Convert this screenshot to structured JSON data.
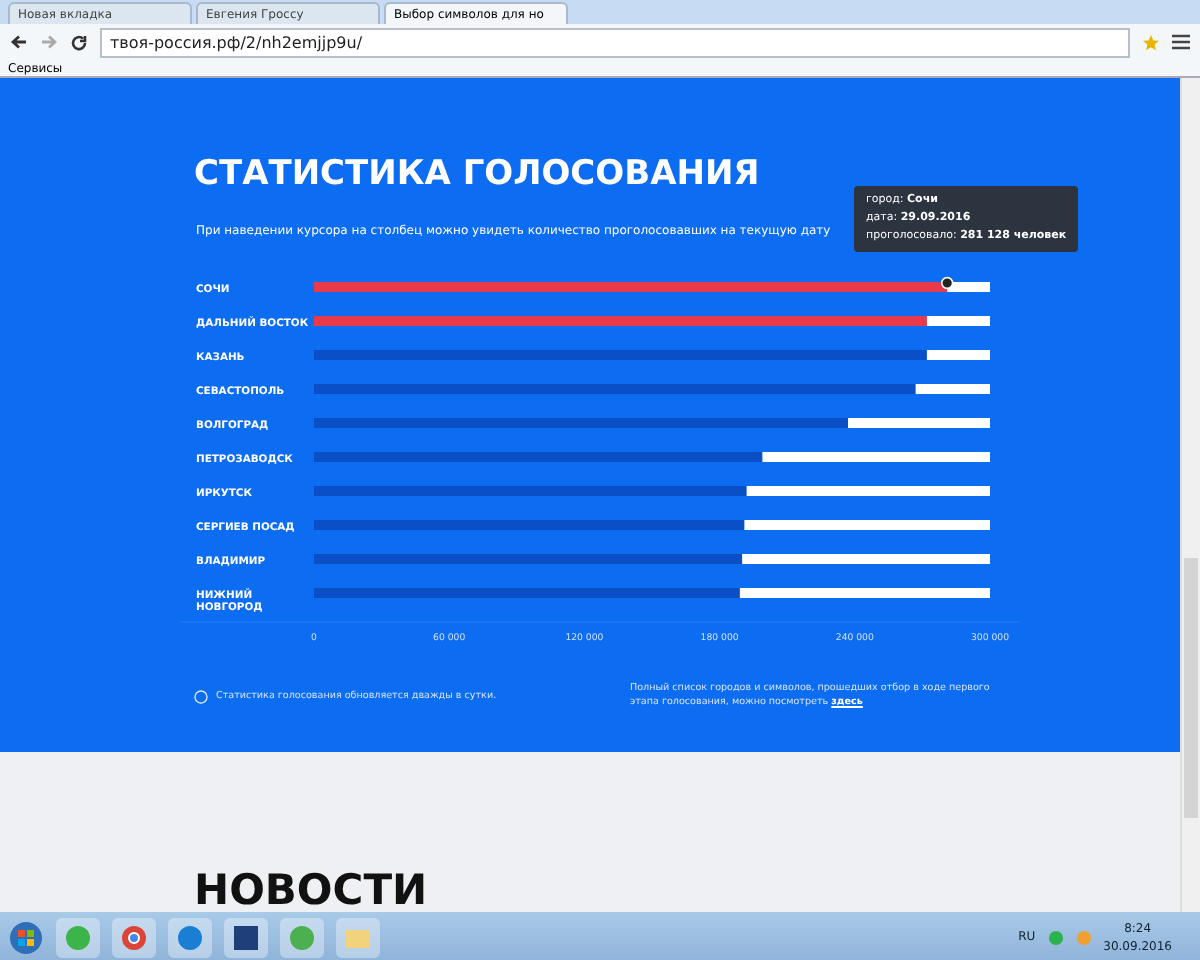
{
  "browser": {
    "tabs": [
      {
        "label": "Новая вкладка",
        "selected": false
      },
      {
        "label": "Евгения Гроссу",
        "selected": false
      },
      {
        "label": "Выбор символов для но",
        "selected": true
      }
    ],
    "url": "твоя-россия.рф/2/nh2emjjp9u/",
    "bookmarks": [
      "Сервисы"
    ]
  },
  "section": {
    "title": "СТАТИСТИКА ГОЛОСОВАНИЯ",
    "subtitle": "При наведении курсора на столбец можно увидеть количество проголосовавших на текущую дату",
    "chart_data": {
      "type": "bar",
      "orientation": "horizontal",
      "stacked": true,
      "categories": [
        "СОЧИ",
        "ДАЛЬНИЙ ВОСТОК",
        "КАЗАНЬ",
        "СЕВАСТОПОЛЬ",
        "ВОЛГОГРАД",
        "ПЕТРОЗАВОДСК",
        "ИРКУТСК",
        "СЕРГИЕВ ПОСАД",
        "ВЛАДИМИР",
        "НИЖНИЙ НОВГОРОД"
      ],
      "series": [
        {
          "color": "#e83a4a",
          "values": [
            281000,
            272000,
            null,
            null,
            null,
            null,
            null,
            null,
            null,
            null
          ]
        },
        {
          "color": "#0b4fc6",
          "values": [
            null,
            null,
            272000,
            267000,
            237000,
            199000,
            192000,
            191000,
            190000,
            189000
          ]
        },
        {
          "color": "#ffffff",
          "values": [
            19000,
            28000,
            28000,
            33000,
            63000,
            101000,
            108000,
            109000,
            110000,
            111000
          ]
        }
      ],
      "xlim": [
        0,
        300000
      ],
      "xticks": [
        {
          "value": 0,
          "label": "0"
        },
        {
          "value": 60000,
          "label": "60 000"
        },
        {
          "value": 120000,
          "label": "120 000"
        },
        {
          "value": 180000,
          "label": "180 000"
        },
        {
          "value": 240000,
          "label": "240 000"
        },
        {
          "value": 300000,
          "label": "300 000"
        }
      ]
    },
    "tooltip": {
      "lines": [
        {
          "label": "город:",
          "value": "Сочи"
        },
        {
          "label": "дата:",
          "value": "29.09.2016"
        },
        {
          "label": "проголосовало:",
          "value": "281 128 человек"
        }
      ]
    },
    "note": "Статистика голосования обновляется дважды в сутки.",
    "list_note": "Полный список городов и символов, прошедших отбор в ходе первого этапа голосования, можно посмотреть",
    "link": "здесь"
  },
  "news": {
    "title": "НОВОСТИ"
  },
  "taskbar": {
    "language": "RU",
    "time": "8:24",
    "date": "30.09.2016"
  }
}
